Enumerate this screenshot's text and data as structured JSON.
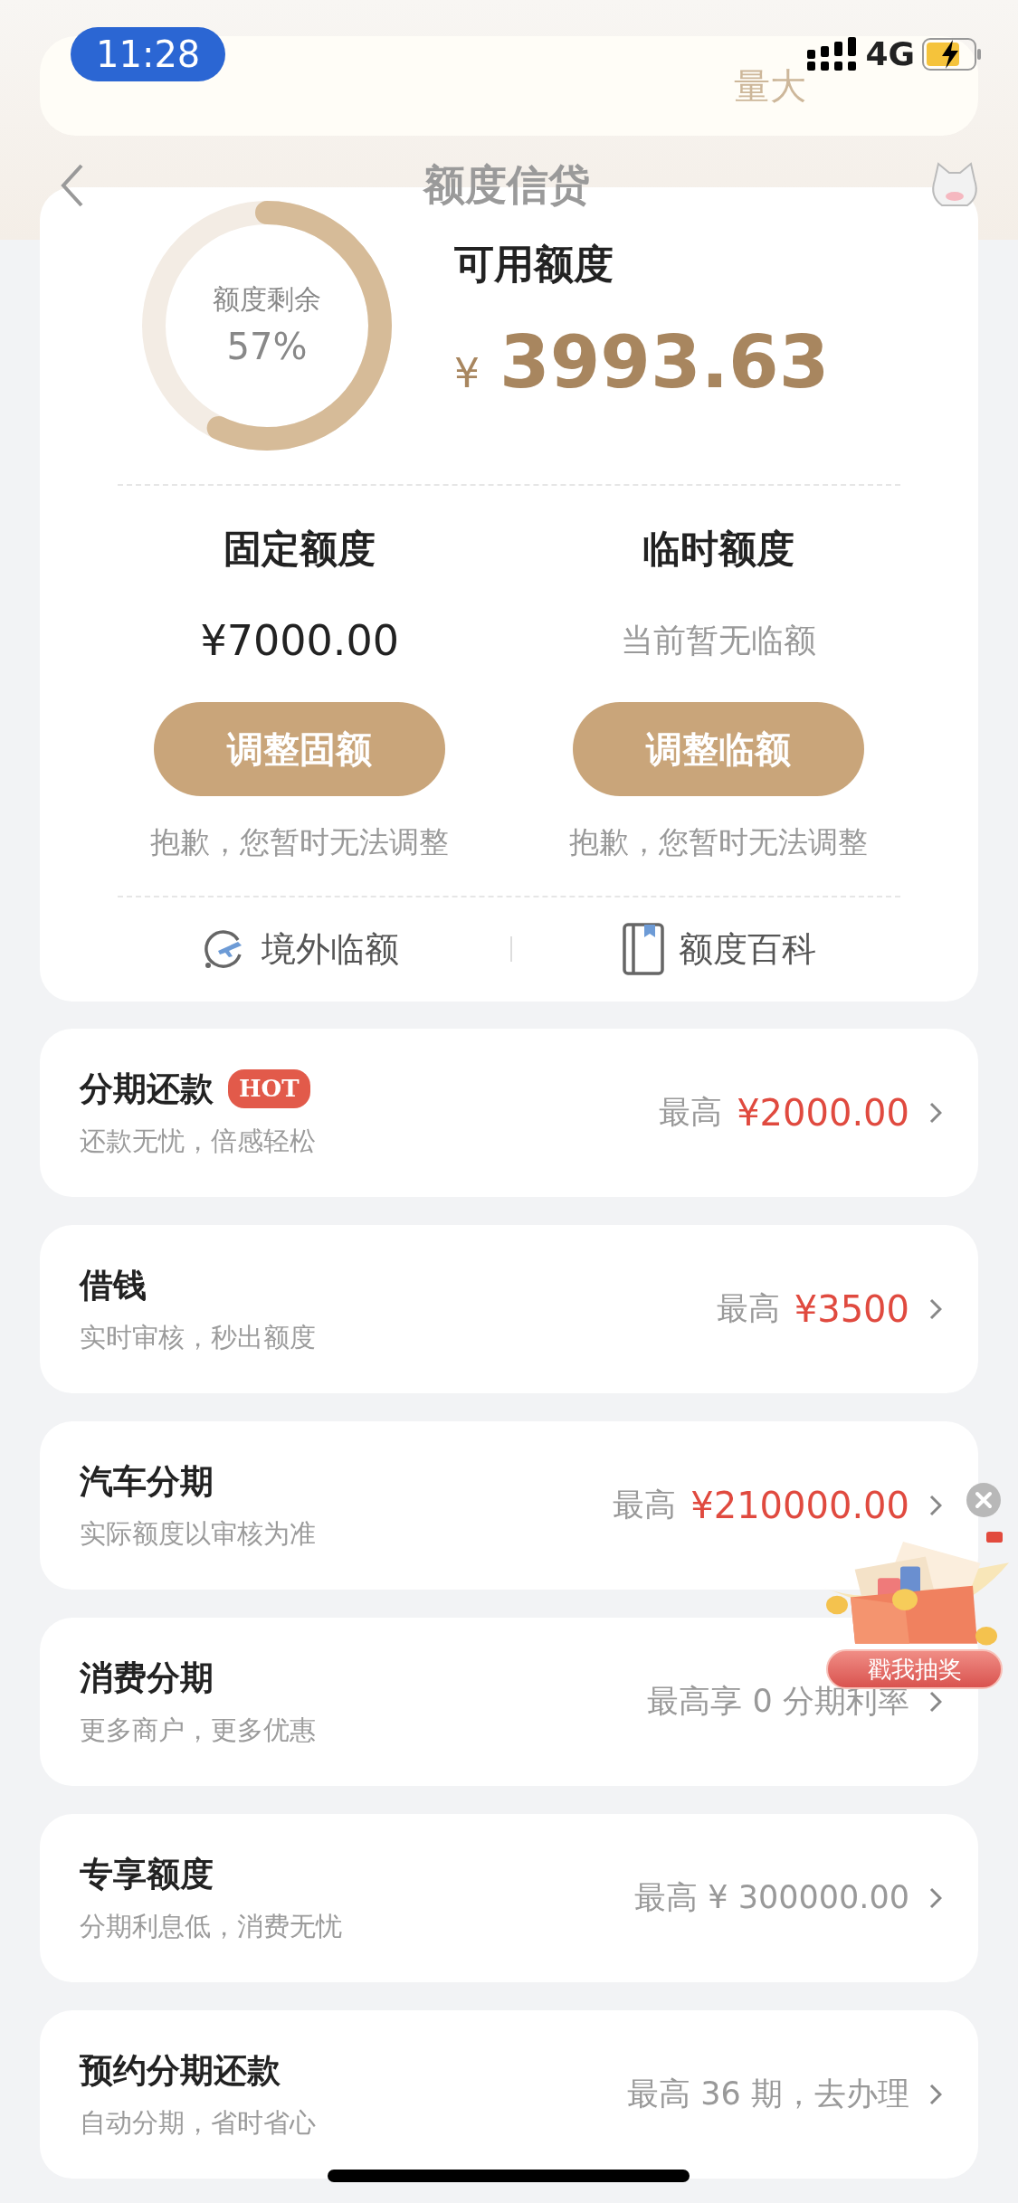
{
  "status_bar": {
    "time": "11:28",
    "network": "4G"
  },
  "banner": {
    "text": "量大"
  },
  "nav": {
    "title": "额度信贷"
  },
  "summary": {
    "ring_label": "额度剩余",
    "ring_percent": "57%",
    "level": 0.57,
    "available_label": "可用额度",
    "currency": "¥",
    "available_amount": "3993.63"
  },
  "limits": [
    {
      "title": "固定额度",
      "value": "¥7000.00",
      "muted": false,
      "button": "调整固额",
      "note": "抱歉，您暂时无法调整"
    },
    {
      "title": "临时额度",
      "value": "当前暂无临额",
      "muted": true,
      "button": "调整临额",
      "note": "抱歉，您暂时无法调整"
    }
  ],
  "links": [
    {
      "kind": "plane",
      "label": "境外临额"
    },
    {
      "kind": "book",
      "label": "额度百科"
    }
  ],
  "products": [
    {
      "kind": "amount",
      "title": "分期还款",
      "badge": "HOT",
      "subtitle": "还款无忧，倍感轻松",
      "prefix": "最高",
      "amount": "¥2000.00"
    },
    {
      "kind": "amount",
      "title": "借钱",
      "subtitle": "实时审核，秒出额度",
      "prefix": "最高",
      "amount": "¥3500"
    },
    {
      "kind": "amount",
      "title": "汽车分期",
      "subtitle": "实际额度以审核为准",
      "prefix": "最高",
      "amount": "¥210000.00"
    },
    {
      "kind": "note",
      "title": "消费分期",
      "subtitle": "更多商户，更多优惠",
      "note": "最高享 0 分期利率"
    },
    {
      "kind": "note",
      "title": "专享额度",
      "subtitle": "分期利息低，消费无忧",
      "note": "最高 ¥ 300000.00"
    },
    {
      "kind": "note",
      "title": "预约分期还款",
      "subtitle": "自动分期，省时省心",
      "note": "最高 36 期，去办理"
    }
  ],
  "promo": {
    "button": "戳我抽奖"
  }
}
